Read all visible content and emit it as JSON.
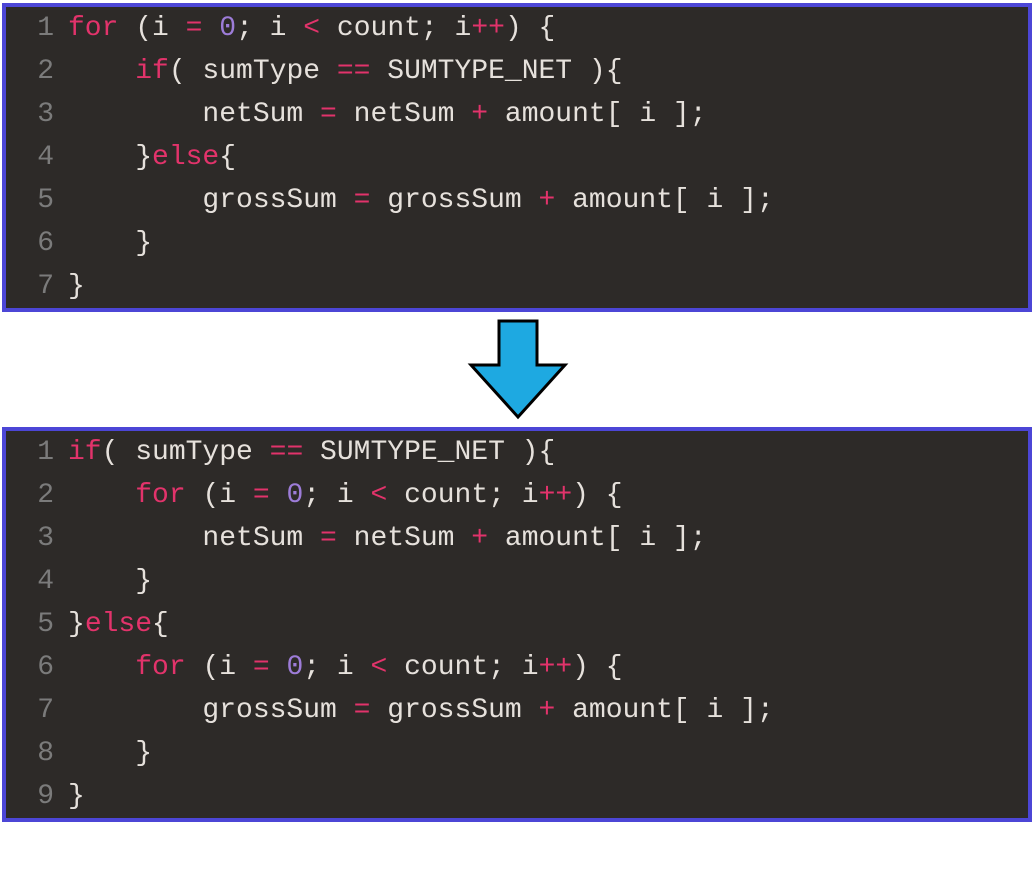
{
  "block1": {
    "lines": [
      {
        "n": "1",
        "code": [
          {
            "t": "for",
            "c": "kw"
          },
          {
            "t": " (i ",
            "c": "id"
          },
          {
            "t": "=",
            "c": "op"
          },
          {
            "t": " ",
            "c": "id"
          },
          {
            "t": "0",
            "c": "num"
          },
          {
            "t": "; i ",
            "c": "id"
          },
          {
            "t": "<",
            "c": "op"
          },
          {
            "t": " count; i",
            "c": "id"
          },
          {
            "t": "++",
            "c": "op"
          },
          {
            "t": ") {",
            "c": "pn"
          }
        ]
      },
      {
        "n": "2",
        "code": [
          {
            "t": "    ",
            "c": "pn"
          },
          {
            "t": "if",
            "c": "kw"
          },
          {
            "t": "( sumType ",
            "c": "id"
          },
          {
            "t": "==",
            "c": "op"
          },
          {
            "t": " SUMTYPE_NET ){",
            "c": "id"
          }
        ]
      },
      {
        "n": "3",
        "code": [
          {
            "t": "        netSum ",
            "c": "id"
          },
          {
            "t": "=",
            "c": "op"
          },
          {
            "t": " netSum ",
            "c": "id"
          },
          {
            "t": "+",
            "c": "op"
          },
          {
            "t": " amount[ i ];",
            "c": "id"
          }
        ]
      },
      {
        "n": "4",
        "code": [
          {
            "t": "    }",
            "c": "pn"
          },
          {
            "t": "else",
            "c": "kw"
          },
          {
            "t": "{",
            "c": "pn"
          }
        ]
      },
      {
        "n": "5",
        "code": [
          {
            "t": "        grossSum ",
            "c": "id"
          },
          {
            "t": "=",
            "c": "op"
          },
          {
            "t": " grossSum ",
            "c": "id"
          },
          {
            "t": "+",
            "c": "op"
          },
          {
            "t": " amount[ i ];",
            "c": "id"
          }
        ]
      },
      {
        "n": "6",
        "code": [
          {
            "t": "    }",
            "c": "pn"
          }
        ]
      },
      {
        "n": "7",
        "code": [
          {
            "t": "}",
            "c": "pn"
          }
        ]
      }
    ]
  },
  "block2": {
    "lines": [
      {
        "n": "1",
        "code": [
          {
            "t": "if",
            "c": "kw"
          },
          {
            "t": "( sumType ",
            "c": "id"
          },
          {
            "t": "==",
            "c": "op"
          },
          {
            "t": " SUMTYPE_NET ){",
            "c": "id"
          }
        ]
      },
      {
        "n": "2",
        "code": [
          {
            "t": "    ",
            "c": "pn"
          },
          {
            "t": "for",
            "c": "kw"
          },
          {
            "t": " (i ",
            "c": "id"
          },
          {
            "t": "=",
            "c": "op"
          },
          {
            "t": " ",
            "c": "id"
          },
          {
            "t": "0",
            "c": "num"
          },
          {
            "t": "; i ",
            "c": "id"
          },
          {
            "t": "<",
            "c": "op"
          },
          {
            "t": " count; i",
            "c": "id"
          },
          {
            "t": "++",
            "c": "op"
          },
          {
            "t": ") {",
            "c": "pn"
          }
        ]
      },
      {
        "n": "3",
        "code": [
          {
            "t": "        netSum ",
            "c": "id"
          },
          {
            "t": "=",
            "c": "op"
          },
          {
            "t": " netSum ",
            "c": "id"
          },
          {
            "t": "+",
            "c": "op"
          },
          {
            "t": " amount[ i ];",
            "c": "id"
          }
        ]
      },
      {
        "n": "4",
        "code": [
          {
            "t": "    }",
            "c": "pn"
          }
        ]
      },
      {
        "n": "5",
        "code": [
          {
            "t": "}",
            "c": "pn"
          },
          {
            "t": "else",
            "c": "kw"
          },
          {
            "t": "{",
            "c": "pn"
          }
        ]
      },
      {
        "n": "6",
        "code": [
          {
            "t": "    ",
            "c": "pn"
          },
          {
            "t": "for",
            "c": "kw"
          },
          {
            "t": " (i ",
            "c": "id"
          },
          {
            "t": "=",
            "c": "op"
          },
          {
            "t": " ",
            "c": "id"
          },
          {
            "t": "0",
            "c": "num"
          },
          {
            "t": "; i ",
            "c": "id"
          },
          {
            "t": "<",
            "c": "op"
          },
          {
            "t": " count; i",
            "c": "id"
          },
          {
            "t": "++",
            "c": "op"
          },
          {
            "t": ") {",
            "c": "pn"
          }
        ]
      },
      {
        "n": "7",
        "code": [
          {
            "t": "        grossSum ",
            "c": "id"
          },
          {
            "t": "=",
            "c": "op"
          },
          {
            "t": " grossSum ",
            "c": "id"
          },
          {
            "t": "+",
            "c": "op"
          },
          {
            "t": " amount[ i ];",
            "c": "id"
          }
        ]
      },
      {
        "n": "8",
        "code": [
          {
            "t": "    }",
            "c": "pn"
          }
        ]
      },
      {
        "n": "9",
        "code": [
          {
            "t": "}",
            "c": "pn"
          }
        ]
      }
    ]
  },
  "arrow": {
    "fill": "#1ea9e1",
    "stroke": "#000000"
  }
}
